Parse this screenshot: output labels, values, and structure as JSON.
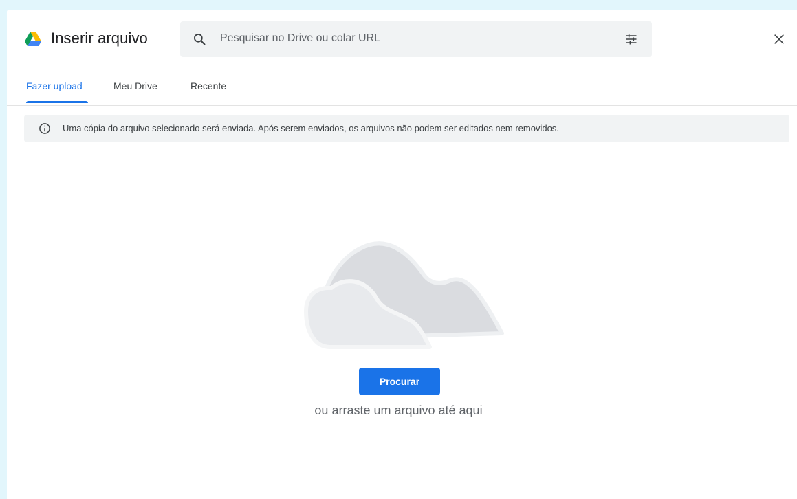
{
  "header": {
    "title": "Inserir arquivo",
    "logo_icon": "google-drive-icon",
    "close_icon": "close-icon"
  },
  "search": {
    "placeholder": "Pesquisar no Drive ou colar URL",
    "icon": "search-icon",
    "filter_icon": "tune-icon"
  },
  "tabs": [
    {
      "label": "Fazer upload",
      "active": true
    },
    {
      "label": "Meu Drive",
      "active": false
    },
    {
      "label": "Recente",
      "active": false
    }
  ],
  "banner": {
    "icon": "info-icon",
    "text": "Uma cópia do arquivo selecionado será enviada. Após serem enviados, os arquivos não podem ser editados nem removidos."
  },
  "upload": {
    "illustration": "cloud-illustration",
    "browse_label": "Procurar",
    "drag_text": "ou arraste um arquivo até aqui"
  },
  "colors": {
    "accent": "#1a73e8",
    "page_bg": "#e2f6fc",
    "surface": "#f1f3f4"
  }
}
